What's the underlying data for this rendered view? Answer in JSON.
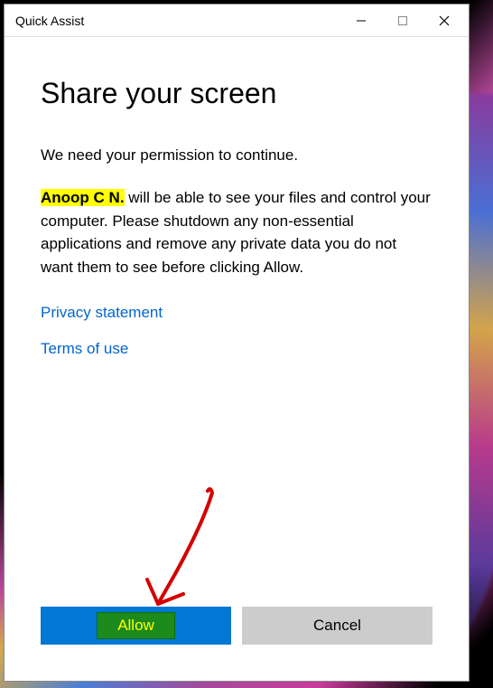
{
  "titlebar": {
    "title": "Quick Assist"
  },
  "content": {
    "heading": "Share your screen",
    "subheading": "We need your permission to continue.",
    "helper_name": "Anoop C N.",
    "body_rest": " will be able to see your files and control your computer. Please shutdown any non-essential applications and remove any private data you do not want them to see before clicking Allow.",
    "privacy_link": "Privacy statement",
    "terms_link": "Terms of use"
  },
  "buttons": {
    "allow": "Allow",
    "cancel": "Cancel"
  }
}
